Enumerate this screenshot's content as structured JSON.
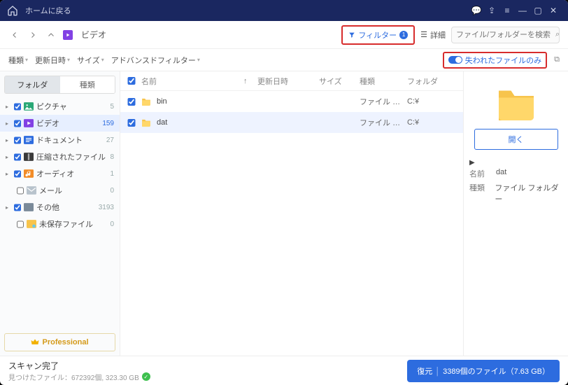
{
  "titlebar": {
    "back_home": "ホームに戻る"
  },
  "toolbar": {
    "location": "ビデオ",
    "filter_label": "フィルター",
    "filter_badge": "1",
    "detail_label": "詳細",
    "search_placeholder": "ファイル/フォルダーを検索"
  },
  "filterbar": {
    "kind": "種類",
    "modified": "更新日時",
    "size": "サイズ",
    "advanced": "アドバンスドフィルター",
    "lost_only": "失われたファイルのみ"
  },
  "sidebar": {
    "tab_folder": "フォルダ",
    "tab_type": "種類",
    "items": [
      {
        "label": "ピクチャ",
        "count": "5",
        "color": "#2aa876"
      },
      {
        "label": "ビデオ",
        "count": "159",
        "color": "#8241e4",
        "active": true
      },
      {
        "label": "ドキュメント",
        "count": "27",
        "color": "#2d6cdf"
      },
      {
        "label": "圧縮されたファイル",
        "count": "8",
        "color": "#3a3a3a"
      },
      {
        "label": "オーディオ",
        "count": "1",
        "color": "#f28c28"
      }
    ],
    "sub1": {
      "label": "メール",
      "count": "0"
    },
    "others": {
      "label": "その他",
      "count": "3193"
    },
    "sub2": {
      "label": "未保存ファイル",
      "count": "0"
    },
    "professional": "Professional"
  },
  "columns": {
    "name": "名前",
    "modified": "更新日時",
    "size": "サイズ",
    "type": "種類",
    "folder": "フォルダ"
  },
  "rows": [
    {
      "name": "bin",
      "type": "ファイル フ…",
      "folder": "C:¥"
    },
    {
      "name": "dat",
      "type": "ファイル フ…",
      "folder": "C:¥",
      "selected": true
    }
  ],
  "preview": {
    "open": "開く",
    "name_k": "名前",
    "name_v": "dat",
    "type_k": "種類",
    "type_v": "ファイル フォルダー"
  },
  "status": {
    "title": "スキャン完了",
    "detail": "見つけたファイル：672392個, 323.30 GB",
    "recover_a": "復元",
    "recover_b": "3389個のファイル（7.63 GB）"
  }
}
